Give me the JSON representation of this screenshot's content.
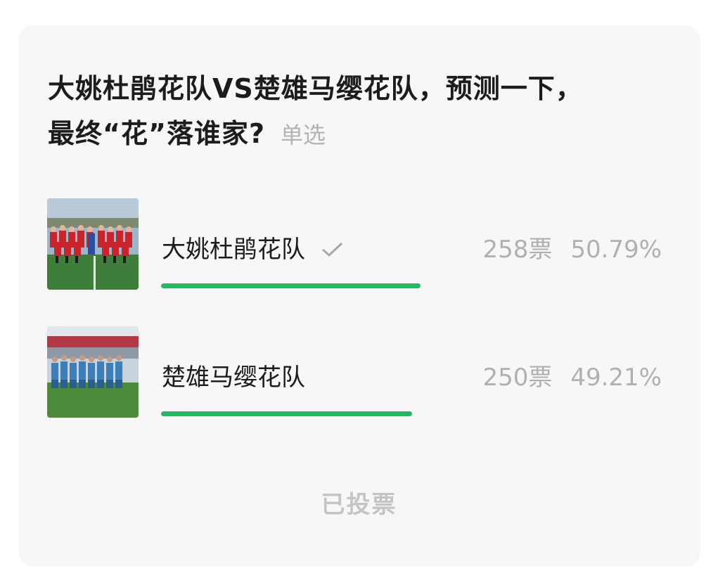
{
  "poll": {
    "title_line1": "大姚杜鹃花队VS楚雄马缨花队，预测一下，",
    "title_line2": "最终“花”落谁家?",
    "type_tag": "单选",
    "options": [
      {
        "label": "大姚杜鹃花队",
        "votes": "258票",
        "percent": "50.79%",
        "fraction": 0.5079,
        "selected": true,
        "check_icon": "check-icon"
      },
      {
        "label": "楚雄马缨花队",
        "votes": "250票",
        "percent": "49.21%",
        "fraction": 0.4921,
        "selected": false
      }
    ],
    "status": "已投票"
  },
  "colors": {
    "bar": "#1fbb5f",
    "card_bg": "#f7f7f7",
    "muted_text": "#b0b0b0"
  }
}
